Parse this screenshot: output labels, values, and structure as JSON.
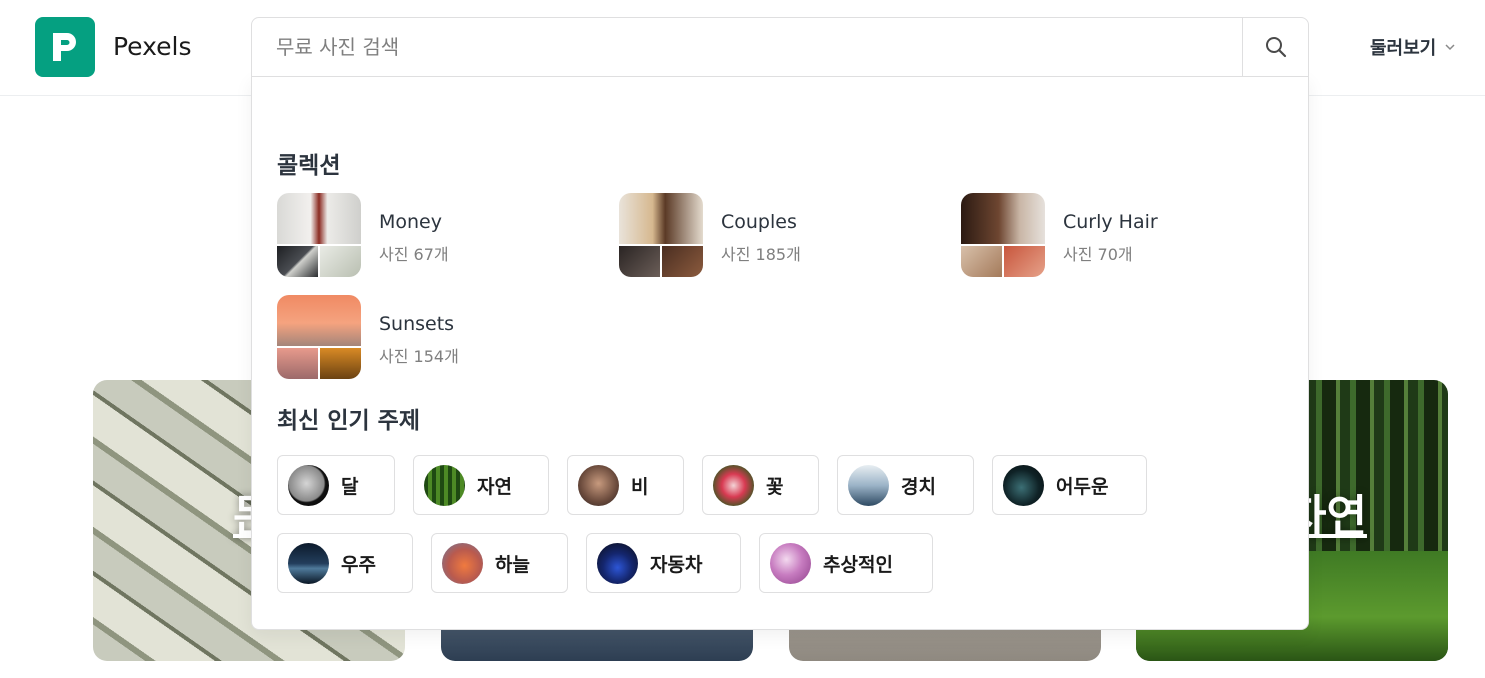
{
  "header": {
    "brand": "Pexels",
    "explore_label": "둘러보기"
  },
  "search": {
    "placeholder": "무료 사진 검색"
  },
  "background_cards": {
    "card1_label": "돈",
    "card4_label": "자연"
  },
  "dropdown": {
    "collections_title": "콜렉션",
    "collections": [
      {
        "name": "Money",
        "count": "사진 67개"
      },
      {
        "name": "Couples",
        "count": "사진 185개"
      },
      {
        "name": "Curly Hair",
        "count": "사진 70개"
      },
      {
        "name": "Sunsets",
        "count": "사진 154개"
      }
    ],
    "trending_title": "최신 인기 주제",
    "topics": [
      {
        "label": "달"
      },
      {
        "label": "자연"
      },
      {
        "label": "비"
      },
      {
        "label": "꽃"
      },
      {
        "label": "경치"
      },
      {
        "label": "어두운"
      },
      {
        "label": "우주"
      },
      {
        "label": "하늘"
      },
      {
        "label": "자동차"
      },
      {
        "label": "추상적인"
      }
    ]
  },
  "colors": {
    "brand_green": "#05a081",
    "text_primary": "#2c343e",
    "text_muted": "#7f7f7f",
    "border": "#dfdfe0"
  },
  "icons": [
    "pexels-logo-icon",
    "search-icon",
    "chevron-down-icon"
  ]
}
